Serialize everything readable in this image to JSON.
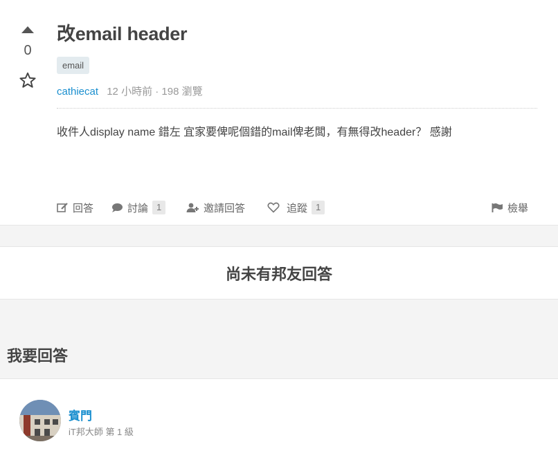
{
  "question": {
    "vote_count": "0",
    "title": "改email header",
    "tags": [
      "email"
    ],
    "author": "cathiecat",
    "meta": "12 小時前 · 198 瀏覽",
    "body": "收件人display name 錯左 宜家要俾呢個錯的mail俾老闆，有無得改header？ 感謝"
  },
  "actions": {
    "answer": "回答",
    "discuss": "討論",
    "discuss_count": "1",
    "invite": "邀請回答",
    "follow": "追蹤",
    "follow_count": "1",
    "report": "檢舉"
  },
  "no_answer_text": "尚未有邦友回答",
  "my_answer_title": "我要回答",
  "user": {
    "name": "賓門",
    "rank": "iT邦大師 第 1 級"
  },
  "colors": {
    "link": "#1a8fcf",
    "band_bg": "#f4f4f4",
    "tag_bg": "#e3ebef"
  }
}
